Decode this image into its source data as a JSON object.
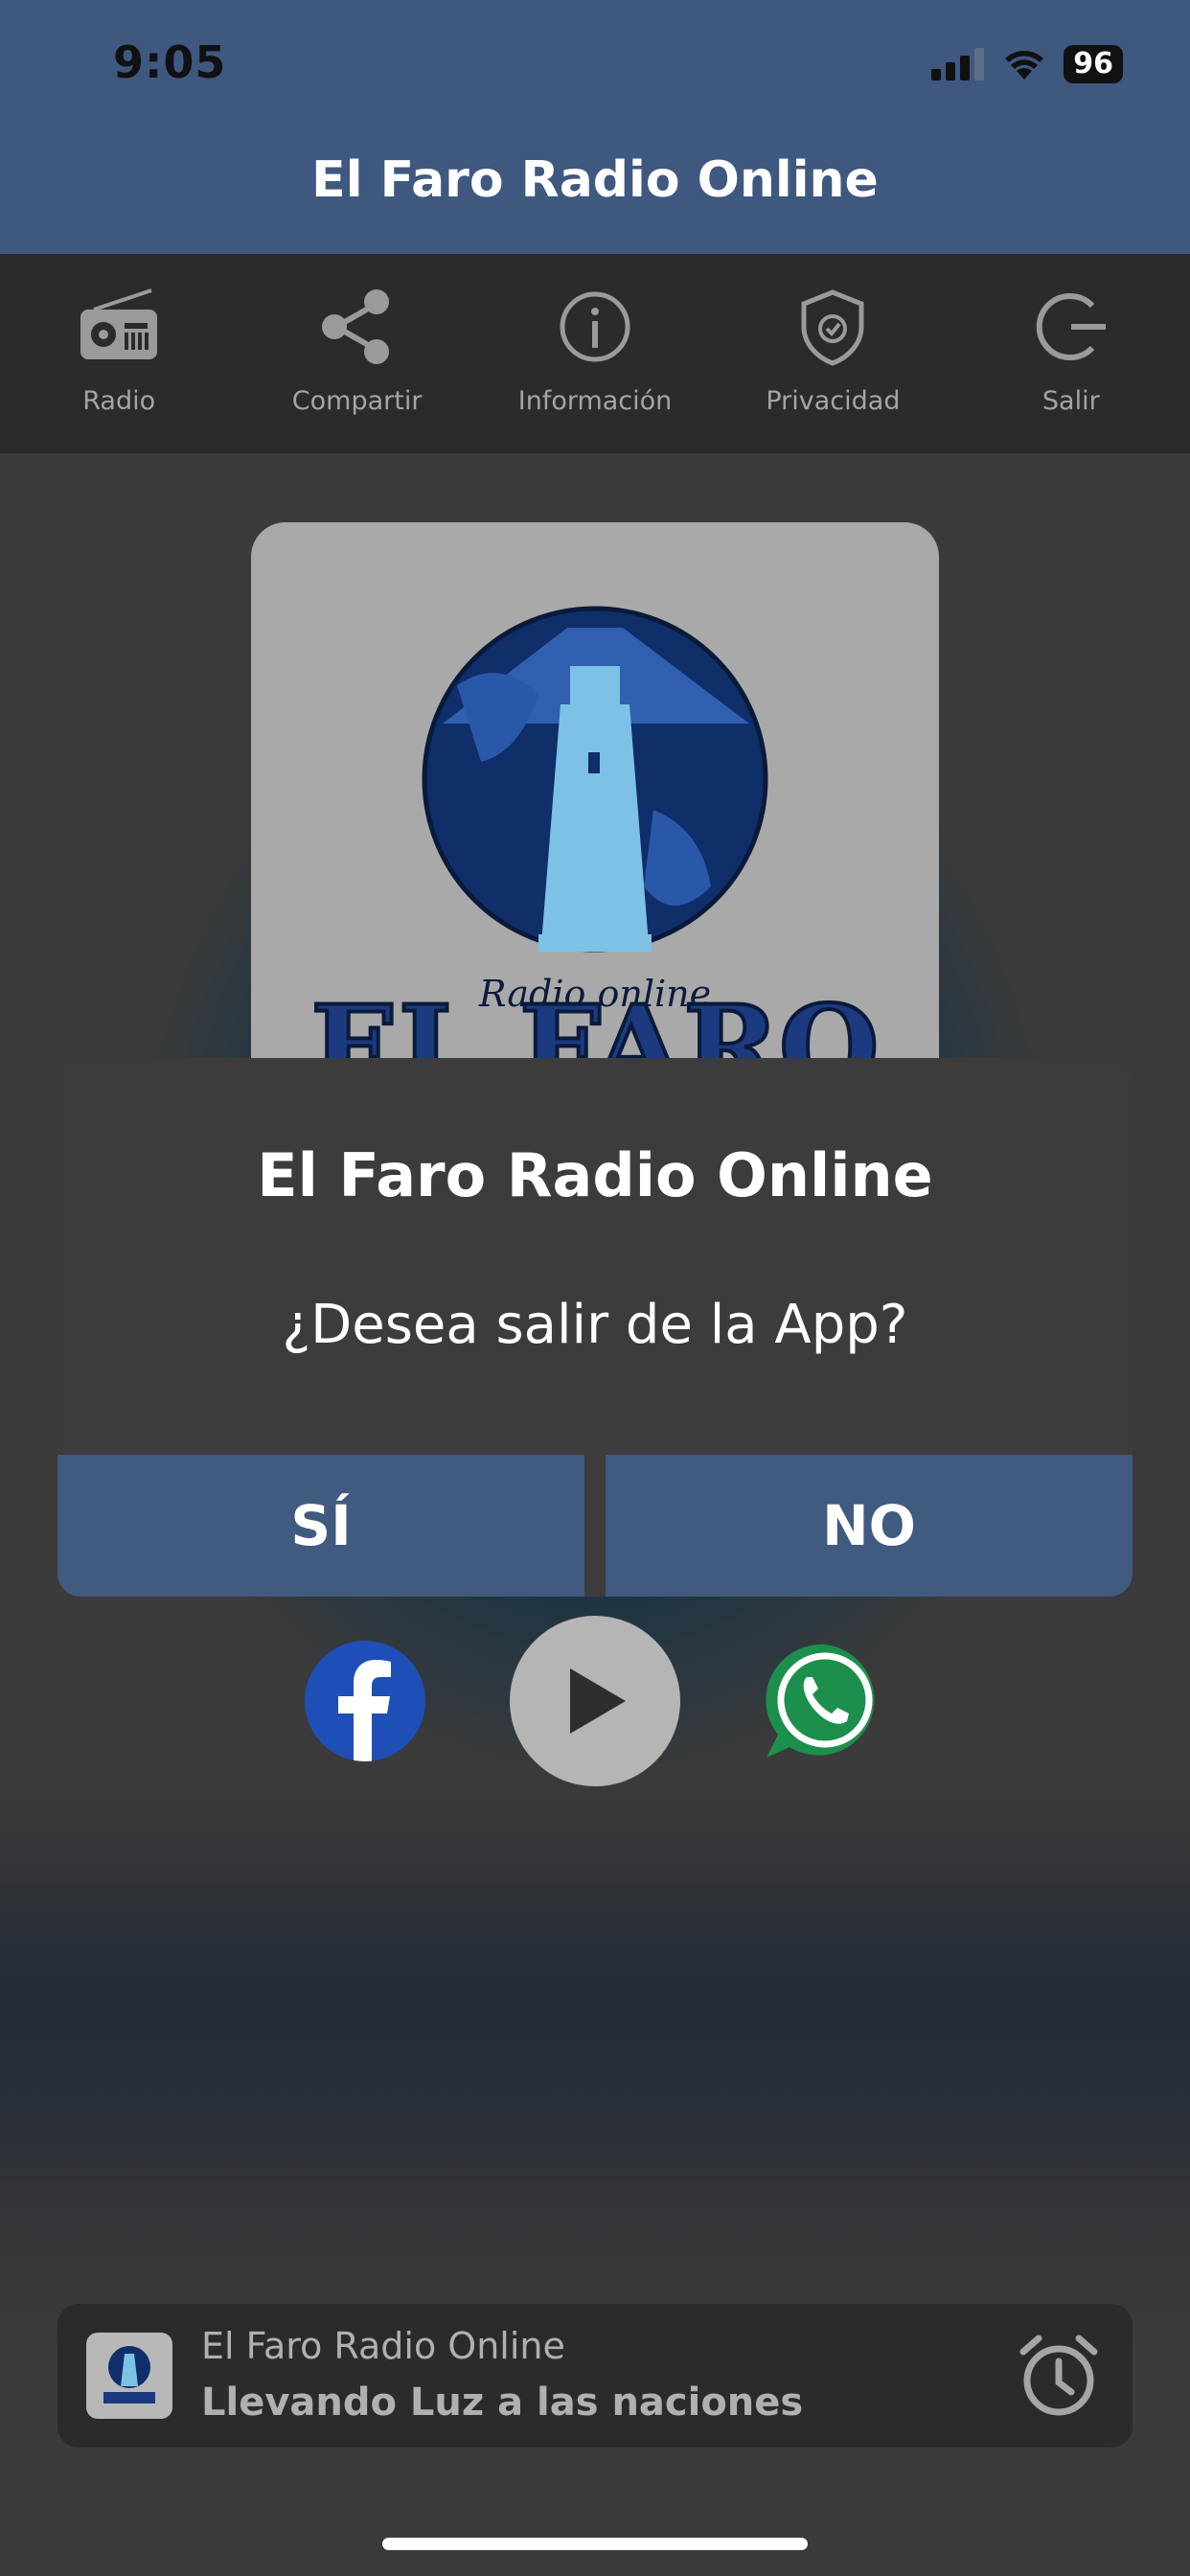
{
  "status": {
    "time": "9:05",
    "battery": "96"
  },
  "app": {
    "title": "El Faro Radio Online"
  },
  "toolbar": {
    "items": [
      {
        "label": "Radio",
        "icon": "radio-icon"
      },
      {
        "label": "Compartir",
        "icon": "share-icon"
      },
      {
        "label": "Información",
        "icon": "info-icon"
      },
      {
        "label": "Privacidad",
        "icon": "shield-icon"
      },
      {
        "label": "Salir",
        "icon": "power-icon"
      }
    ]
  },
  "cover": {
    "logo_script": "Radio online",
    "logo_text": "EL FARO"
  },
  "dialog": {
    "title": "El Faro Radio Online",
    "message": "¿Desea salir de la App?",
    "yes_label": "SÍ",
    "no_label": "NO"
  },
  "controls": {
    "facebook_icon": "facebook-icon",
    "play_icon": "play-icon",
    "whatsapp_icon": "whatsapp-icon"
  },
  "mini_player": {
    "title": "El Faro Radio Online",
    "subtitle": "Llevando Luz a las naciones",
    "alarm_icon": "alarm-clock-icon"
  },
  "colors": {
    "accent": "#415a80",
    "toolbar": "#2b2b2b",
    "dialog": "#3c3c3c"
  }
}
